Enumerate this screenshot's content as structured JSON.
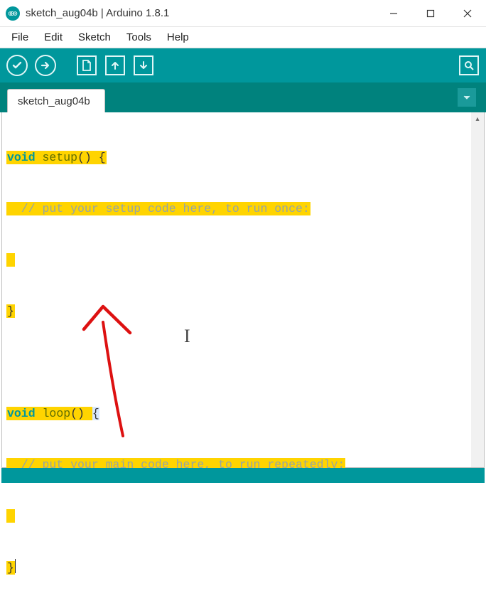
{
  "window": {
    "title": "sketch_aug04b | Arduino 1.8.1"
  },
  "menu": {
    "file": "File",
    "edit": "Edit",
    "sketch": "Sketch",
    "tools": "Tools",
    "help": "Help"
  },
  "toolbar": {
    "verify": "verify",
    "upload": "upload",
    "new": "new",
    "open": "open",
    "save": "save",
    "serial_monitor": "serial-monitor"
  },
  "tabs": {
    "active": "sketch_aug04b"
  },
  "code": {
    "l1_kw": "void",
    "l1_fn": " setup",
    "l1_rest": "() {",
    "l2": "  // put your setup code here, to run once:",
    "l3": " ",
    "l4": "}",
    "l5": "",
    "l6_kw": "void",
    "l6_fn": " loop",
    "l6_rest_a": "() ",
    "l6_brace": "{",
    "l7": "  // put your main code here, to run repeatedly:",
    "l8": " ",
    "l9": "}"
  }
}
